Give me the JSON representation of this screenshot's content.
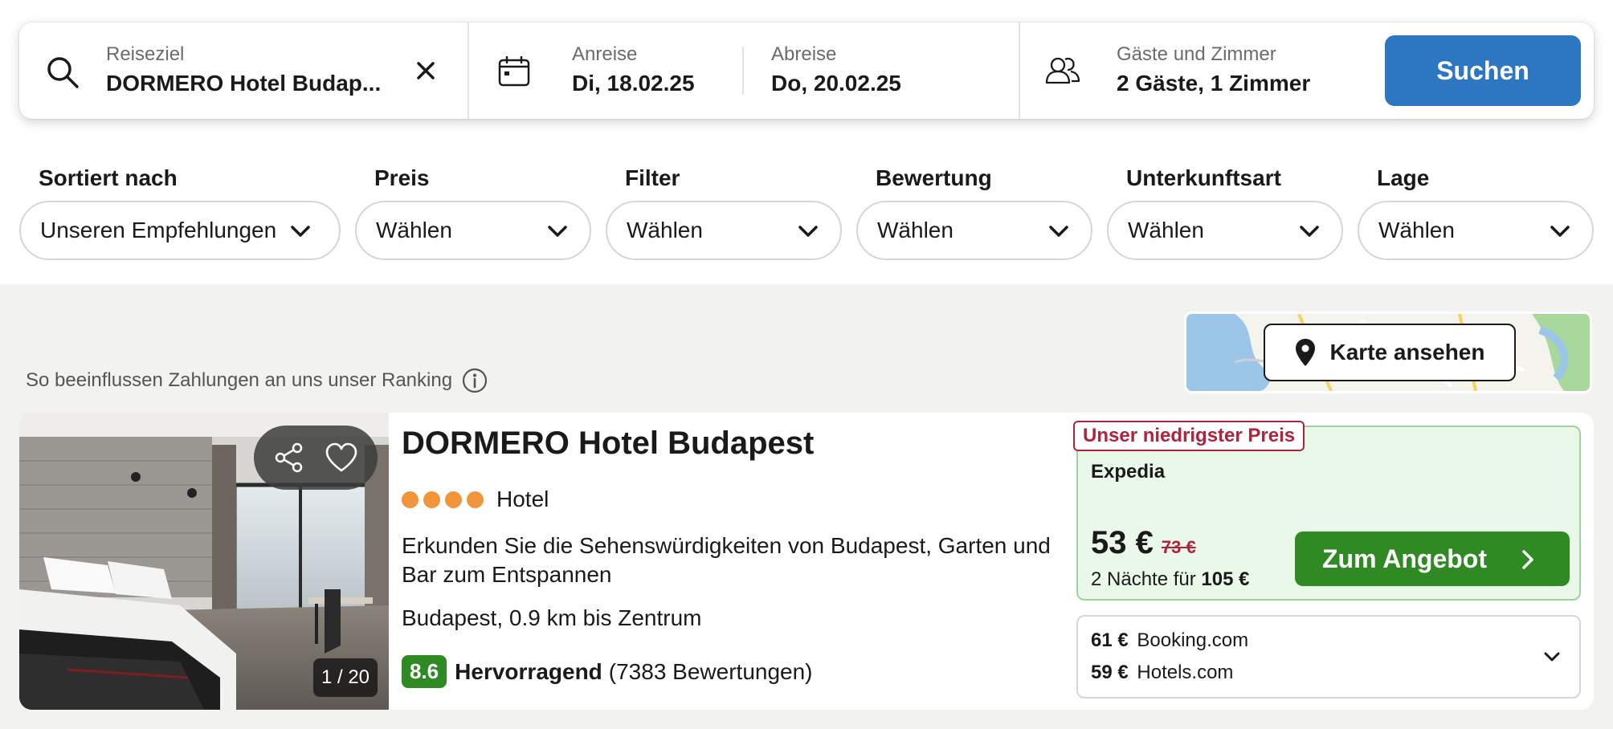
{
  "search": {
    "destination_label": "Reiseziel",
    "destination_value": "DORMERO Hotel Budap...",
    "checkin_label": "Anreise",
    "checkin_value": "Di, 18.02.25",
    "checkout_label": "Abreise",
    "checkout_value": "Do, 20.02.25",
    "guests_label": "Gäste und Zimmer",
    "guests_value": "2 Gäste, 1 Zimmer",
    "search_button": "Suchen"
  },
  "filters": [
    {
      "title": "Sortiert nach",
      "value": "Unseren Empfehlungen"
    },
    {
      "title": "Preis",
      "value": "Wählen"
    },
    {
      "title": "Filter",
      "value": "Wählen"
    },
    {
      "title": "Bewertung",
      "value": "Wählen"
    },
    {
      "title": "Unterkunftsart",
      "value": "Wählen"
    },
    {
      "title": "Lage",
      "value": "Wählen"
    }
  ],
  "results": {
    "ranking_note": "So beeinflussen Zahlungen an uns unser Ranking",
    "map_button": "Karte ansehen"
  },
  "hotel": {
    "name": "DORMERO Hotel Budapest",
    "stars": 4,
    "type": "Hotel",
    "description": "Erkunden Sie die Sehenswürdigkeiten von Budapest, Garten und Bar zum Entspannen",
    "location": "Budapest, 0.9 km bis Zentrum",
    "score": "8.6",
    "rating_word": "Hervorragend",
    "reviews": "(7383 Bewertungen)",
    "photo_counter": "1 / 20"
  },
  "deal": {
    "badge": "Unser niedrigster Preis",
    "provider": "Expedia",
    "price": "53 €",
    "old_price": "73 €",
    "nights_text": "2 Nächte für",
    "total_price": "105 €",
    "cta": "Zum Angebot"
  },
  "other_offers": [
    {
      "price": "61 €",
      "provider": "Booking.com"
    },
    {
      "price": "59 €",
      "provider": "Hotels.com"
    }
  ],
  "colors": {
    "primary_blue": "#2d76c2",
    "offer_green": "#2f8a23",
    "deal_background": "#eaf8ea",
    "badge_red": "#b0233f",
    "star_orange": "#f0953a"
  }
}
